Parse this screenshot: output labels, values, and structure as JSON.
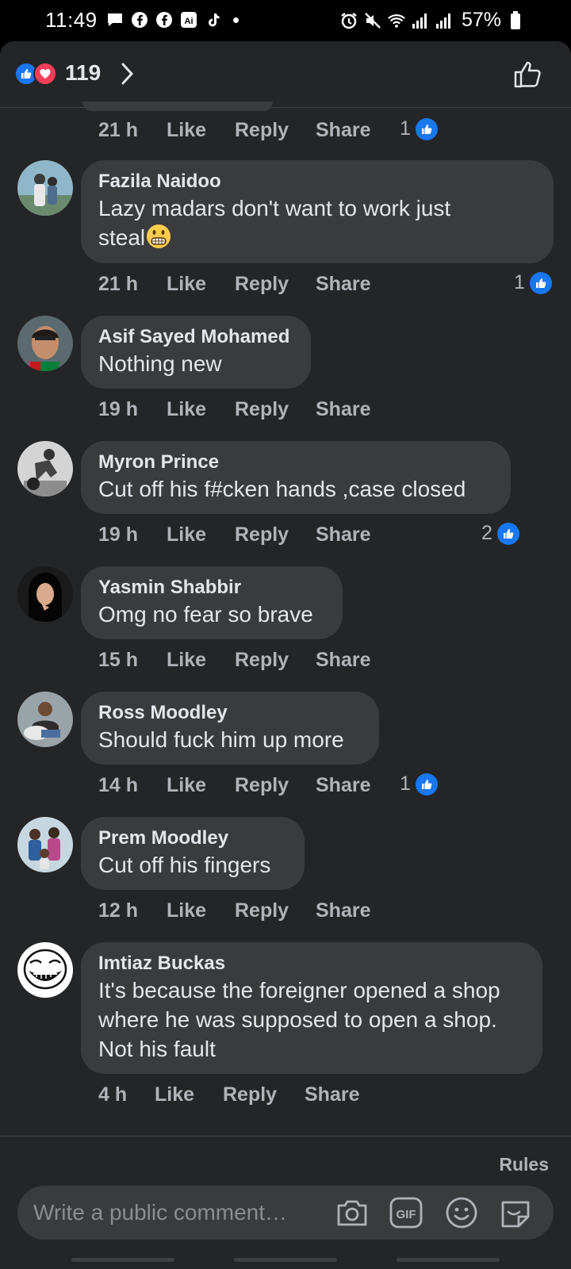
{
  "status_bar": {
    "time": "11:49",
    "battery": "57%"
  },
  "reactions": {
    "count": "119"
  },
  "first_actions": {
    "time": "21 h",
    "like": "Like",
    "reply": "Reply",
    "share": "Share",
    "likes": "1"
  },
  "comments": [
    {
      "author": "Fazila Naidoo",
      "lines": [
        "Lazy madars don't want to work just",
        "steal"
      ],
      "time": "21 h",
      "like": "Like",
      "reply": "Reply",
      "share": "Share",
      "likes": "1"
    },
    {
      "author": "Asif Sayed Mohamed",
      "lines": [
        "Nothing  new"
      ],
      "time": "19 h",
      "like": "Like",
      "reply": "Reply",
      "share": "Share",
      "likes": ""
    },
    {
      "author": "Myron Prince",
      "lines": [
        "Cut off his f#cken hands ,case closed"
      ],
      "time": "19 h",
      "like": "Like",
      "reply": "Reply",
      "share": "Share",
      "likes": "2"
    },
    {
      "author": "Yasmin Shabbir",
      "lines": [
        "Omg no fear so brave"
      ],
      "time": "15 h",
      "like": "Like",
      "reply": "Reply",
      "share": "Share",
      "likes": ""
    },
    {
      "author": "Ross Moodley",
      "lines": [
        "Should fuck him up more"
      ],
      "time": "14 h",
      "like": "Like",
      "reply": "Reply",
      "share": "Share",
      "likes": "1"
    },
    {
      "author": "Prem Moodley",
      "lines": [
        "Cut off his fingers"
      ],
      "time": "12 h",
      "like": "Like",
      "reply": "Reply",
      "share": "Share",
      "likes": ""
    },
    {
      "author": "Imtiaz Buckas",
      "lines": [
        "It's because the foreigner opened a shop",
        "where he was supposed to open a shop.",
        "Not his fault"
      ],
      "time": "4 h",
      "like": "Like",
      "reply": "Reply",
      "share": "Share",
      "likes": ""
    }
  ],
  "compose": {
    "rules": "Rules",
    "placeholder": "Write a public comment…"
  },
  "colors": {
    "accent": "#1877f2",
    "love": "#f33e58",
    "bubble": "#3a3b3c",
    "sheet": "#242526"
  }
}
